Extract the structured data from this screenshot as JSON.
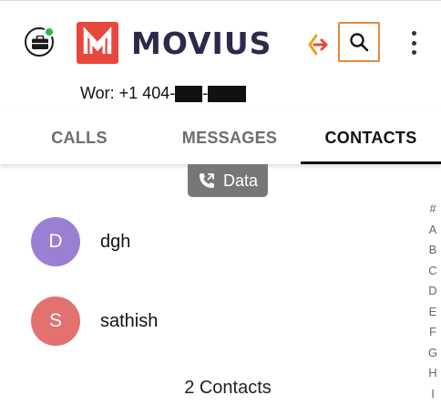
{
  "header": {
    "logo_text": "MOVIUS",
    "work_number_prefix": "Wor: +1 404-",
    "work_number_suffix": "-",
    "icons": {
      "work_badge": "briefcase-icon",
      "presence": "online-status-dot",
      "transfer": "transfer-arrows-icon",
      "search": "search-icon",
      "more": "more-vert-icon"
    },
    "colors": {
      "brand_red": "#e8473c",
      "brand_navy": "#2b2a4a",
      "presence_green": "#2fb84a",
      "accent_orange": "#e8873a"
    }
  },
  "tabs": [
    {
      "label": "CALLS",
      "active": false
    },
    {
      "label": "MESSAGES",
      "active": false
    },
    {
      "label": "CONTACTS",
      "active": true
    }
  ],
  "data_chip": {
    "label": "Data",
    "icon": "wifi-call-icon"
  },
  "contacts": [
    {
      "initial": "D",
      "name": "dgh",
      "color": "#9b7fd3"
    },
    {
      "initial": "S",
      "name": "sathish",
      "color": "#e2716f"
    }
  ],
  "contacts_count": "2 Contacts",
  "alpha_index": [
    "#",
    "A",
    "B",
    "C",
    "D",
    "E",
    "F",
    "G",
    "H",
    "I"
  ]
}
